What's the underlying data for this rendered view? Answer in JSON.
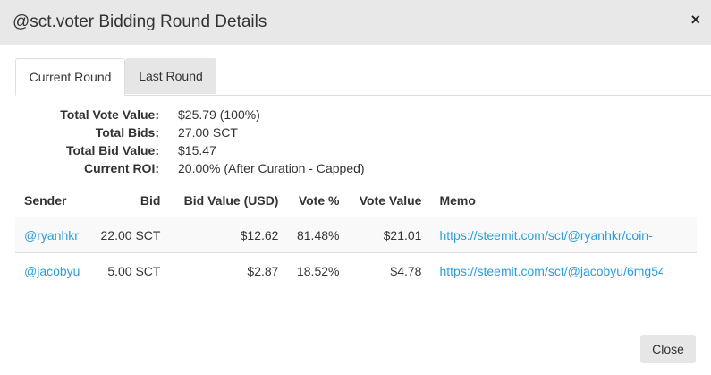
{
  "modal": {
    "title": "@sct.voter Bidding Round Details",
    "close_icon": "×",
    "close_button_label": "Close"
  },
  "tabs": [
    {
      "label": "Current Round",
      "active": true
    },
    {
      "label": "Last Round",
      "active": false
    }
  ],
  "summary": [
    {
      "label": "Total Vote Value:",
      "value": "$25.79 (100%)"
    },
    {
      "label": "Total Bids:",
      "value": "27.00 SCT"
    },
    {
      "label": "Total Bid Value:",
      "value": "$15.47"
    },
    {
      "label": "Current ROI:",
      "value": "20.00% (After Curation - Capped)"
    }
  ],
  "table": {
    "headers": [
      "Sender",
      "Bid",
      "Bid Value (USD)",
      "Vote %",
      "Vote Value",
      "Memo"
    ],
    "rows": [
      {
        "sender": "@ryanhkr",
        "bid": "22.00 SCT",
        "bid_value": "$12.62",
        "vote_pct": "81.48%",
        "vote_value": "$21.01",
        "memo": "https://steemit.com/sct/@ryanhkr/coin-"
      },
      {
        "sender": "@jacobyu",
        "bid": "5.00 SCT",
        "bid_value": "$2.87",
        "vote_pct": "18.52%",
        "vote_value": "$4.78",
        "memo": "https://steemit.com/sct/@jacobyu/6mg54"
      }
    ]
  },
  "colors": {
    "header_bg": "#e8e8e8",
    "link": "#2a9fd6",
    "row_stripe": "#f9f9f9",
    "border": "#dddddd"
  }
}
